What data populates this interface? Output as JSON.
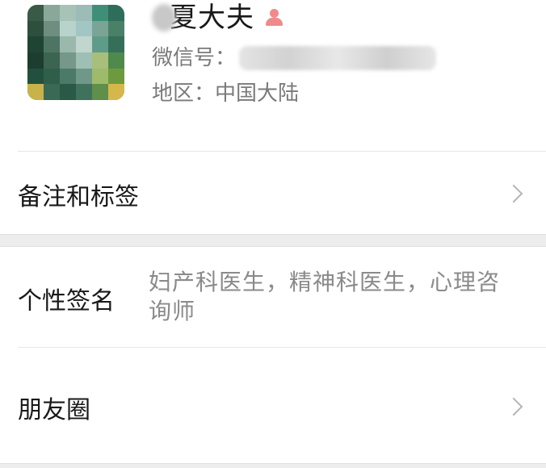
{
  "profile": {
    "name": "夏大夫",
    "wechat_id_label": "微信号：",
    "region_label": "地区：",
    "region_value": "中国大陆",
    "gender_icon": "female-icon",
    "gender_color": "#f08a8a"
  },
  "cells": {
    "remarks_tags": {
      "label": "备注和标签"
    },
    "signature": {
      "label": "个性签名",
      "value": "妇产科医生，精神科医生，心理咨询师"
    },
    "moments": {
      "label": "朋友圈"
    }
  },
  "icons": {
    "chevron": "chevron-right-icon"
  },
  "colors": {
    "background": "#ffffff",
    "section_gap": "#ededed",
    "primary_text": "#191919",
    "secondary_text": "#8a8a8a",
    "divider": "#e6e6e6",
    "chevron": "#b5b5b5"
  }
}
